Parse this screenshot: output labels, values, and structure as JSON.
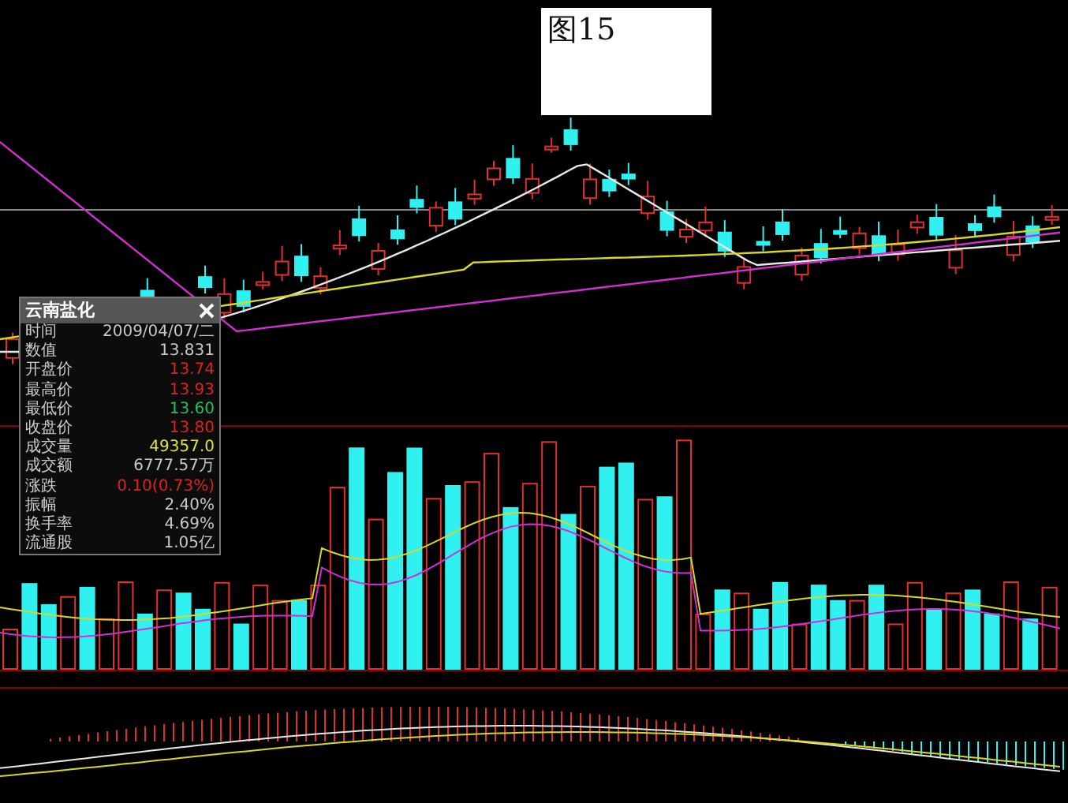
{
  "figure_label": "图15",
  "info_panel": {
    "title": "云南盐化",
    "rows": [
      {
        "label": "时间",
        "value": "2009/04/07/二",
        "color": "#c8c8c8"
      },
      {
        "label": "数值",
        "value": "13.831",
        "color": "#c8c8c8"
      },
      {
        "label": "开盘价",
        "value": "13.74",
        "color": "#e02020"
      },
      {
        "label": "最高价",
        "value": "13.93",
        "color": "#e02020"
      },
      {
        "label": "最低价",
        "value": "13.60",
        "color": "#20c060"
      },
      {
        "label": "收盘价",
        "value": "13.80",
        "color": "#e02020"
      },
      {
        "label": "成交量",
        "value": "49357.0",
        "color": "#e0e040"
      },
      {
        "label": "成交额",
        "value": "6777.57万",
        "color": "#c8c8c8"
      },
      {
        "label": "涨跌",
        "value": "0.10(0.73%)",
        "color": "#e02020"
      },
      {
        "label": "振幅",
        "value": "2.40%",
        "color": "#c8c8c8"
      },
      {
        "label": "换手率",
        "value": "4.69%",
        "color": "#c8c8c8"
      },
      {
        "label": "流通股",
        "value": "1.05亿",
        "color": "#c8c8c8"
      }
    ]
  }
}
